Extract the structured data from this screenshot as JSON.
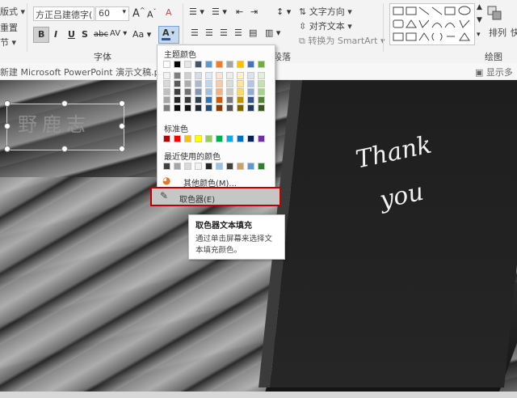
{
  "ribbon": {
    "left_items": [
      "版式",
      "重置",
      "节"
    ],
    "font_name": "方正吕建德字(",
    "font_size": "60",
    "grow_font": "A",
    "shrink_font": "A",
    "clear_format_label": "A",
    "format_buttons": [
      "B",
      "I",
      "U",
      "S",
      "abc",
      "AV",
      "Aa",
      "A"
    ],
    "font_group_label": "字体",
    "text_direction_label": "文字方向",
    "align_text_label": "对齐文本",
    "smartart_label": "转换为 SmartArt",
    "paragraph_group_label": "段落",
    "arrange_label": "排列",
    "quick_label": "快",
    "drawing_group_label": "绘图",
    "show_more_label": "显示多"
  },
  "docbar": {
    "title": "新建 Microsoft PowerPoint 演示文稿.pptx"
  },
  "slide": {
    "textbox_text": "野鹿志",
    "board_text_line1": "Thank",
    "board_text_line2": "you"
  },
  "color_menu": {
    "theme_colors_label": "主题颜色",
    "standard_colors_label": "标准色",
    "recent_colors_label": "最近使用的颜色",
    "more_colors_label": "其他颜色(M)...",
    "eyedropper_label": "取色器(E)",
    "theme_top_row": [
      "#ffffff",
      "#000000",
      "#e7e6e6",
      "#44546a",
      "#5b9bd5",
      "#ed7d31",
      "#a5a5a5",
      "#ffc000",
      "#4472c4",
      "#70ad47"
    ],
    "theme_shades": [
      [
        "#f2f2f2",
        "#7f7f7f",
        "#d0cece",
        "#d6dce4",
        "#deebf6",
        "#fbe5d5",
        "#ededed",
        "#fff2cc",
        "#dae3f3",
        "#e2efd9"
      ],
      [
        "#d8d8d8",
        "#595959",
        "#aeabab",
        "#adb9ca",
        "#bdd7ee",
        "#f8cbad",
        "#dbdbdb",
        "#fee599",
        "#b4c6e7",
        "#c5e0b3"
      ],
      [
        "#bfbfbf",
        "#3f3f3f",
        "#757070",
        "#8496b0",
        "#9cc3e5",
        "#f4b183",
        "#c9c9c9",
        "#ffd965",
        "#8faadc",
        "#a8d08d"
      ],
      [
        "#a5a5a5",
        "#262626",
        "#3a3838",
        "#323f4f",
        "#2e75b5",
        "#c55a11",
        "#7b7b7b",
        "#bf9000",
        "#2f5496",
        "#538135"
      ],
      [
        "#7f7f7f",
        "#0c0c0c",
        "#171616",
        "#222a35",
        "#1e4e79",
        "#833c0b",
        "#525252",
        "#7f6000",
        "#1f3864",
        "#375623"
      ]
    ],
    "standard_colors": [
      "#c00000",
      "#ff0000",
      "#ffc000",
      "#ffff00",
      "#92d050",
      "#00b050",
      "#00b0f0",
      "#0070c0",
      "#002060",
      "#7030a0"
    ],
    "recent_colors": [
      "#404040",
      "#a5a5a5",
      "#d9d9d9",
      "#f2f2f2",
      "#262626",
      "#9dc3e6",
      "#404040",
      "#c9a06c",
      "#5b9bd5",
      "#2e7d32"
    ]
  },
  "tooltip": {
    "title": "取色器文本填充",
    "body_line1": "通过单击屏幕来选择文",
    "body_line2": "本填充颜色。"
  }
}
